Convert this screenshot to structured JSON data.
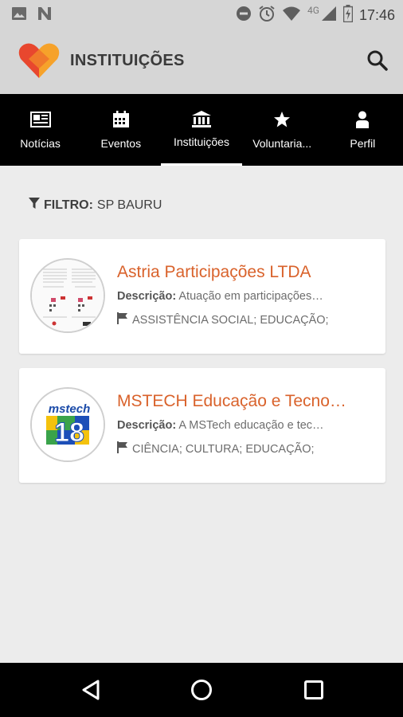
{
  "status_bar": {
    "time": "17:46",
    "network": "4G",
    "icons": [
      "image-icon",
      "n-icon",
      "do-not-disturb-icon",
      "alarm-icon",
      "wifi-icon",
      "signal-icon",
      "battery-icon"
    ]
  },
  "app_bar": {
    "title": "INSTITUIÇÕES",
    "logo": "heart-logo-icon",
    "search_icon": "search-icon"
  },
  "tabs": [
    {
      "label": "Notícias",
      "icon": "news-icon",
      "active": false
    },
    {
      "label": "Eventos",
      "icon": "calendar-icon",
      "active": false
    },
    {
      "label": "Instituições",
      "icon": "institution-icon",
      "active": true
    },
    {
      "label": "Voluntaria...",
      "icon": "star-icon",
      "active": false
    },
    {
      "label": "Perfil",
      "icon": "person-icon",
      "active": false
    }
  ],
  "filter": {
    "key": "FILTRO:",
    "value": "SP BAURU"
  },
  "institutions": [
    {
      "name": "Astria Participações LTDA",
      "desc_label": "Descrição:",
      "description": "Atuação em participações…",
      "tags": "ASSISTÊNCIA SOCIAL; EDUCAÇÃO;"
    },
    {
      "name": "MSTECH Educação e Tecno…",
      "desc_label": "Descrição:",
      "description": "A MSTech educação e tec…",
      "tags": "CIÊNCIA; CULTURA; EDUCAÇÃO;",
      "logo_text": "mstech",
      "logo_number": "18"
    }
  ],
  "colors": {
    "accent": "#d9622b",
    "tab_bar": "#000000",
    "app_bar": "#d6d6d6",
    "background": "#ececec"
  }
}
